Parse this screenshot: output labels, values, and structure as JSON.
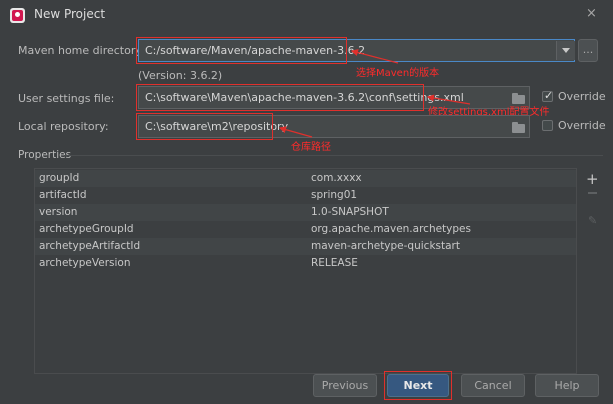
{
  "window": {
    "title": "New Project",
    "close_glyph": "×"
  },
  "form": {
    "maven_home_label": "Maven home directory:",
    "maven_home_value": "C:/software/Maven/apache-maven-3.6.2",
    "maven_version": "(Version: 3.6.2)",
    "settings_label": "User settings file:",
    "settings_value": "C:\\software\\Maven\\apache-maven-3.6.2\\conf\\settings.xml",
    "settings_override_label": "Override",
    "settings_override_checked": true,
    "repo_label": "Local repository:",
    "repo_value": "C:\\software\\m2\\repository",
    "repo_override_label": "Override",
    "repo_override_checked": false,
    "browse_label": "..."
  },
  "annotations": {
    "maven_version_note": "选择Maven的版本",
    "settings_note": "修改settings.xml配置文件",
    "repo_note": "仓库路径"
  },
  "properties": {
    "section_label": "Properties",
    "rows": [
      {
        "key": "groupId",
        "value": "com.xxxx"
      },
      {
        "key": "artifactId",
        "value": "spring01"
      },
      {
        "key": "version",
        "value": "1.0-SNAPSHOT"
      },
      {
        "key": "archetypeGroupId",
        "value": "org.apache.maven.archetypes"
      },
      {
        "key": "archetypeArtifactId",
        "value": "maven-archetype-quickstart"
      },
      {
        "key": "archetypeVersion",
        "value": "RELEASE"
      }
    ]
  },
  "buttons": {
    "previous": "Previous",
    "next": "Next",
    "cancel": "Cancel",
    "help": "Help"
  },
  "colors": {
    "background": "#3c3f41",
    "field": "#45494a",
    "annotation_red": "#e0302c",
    "primary_button": "#365880",
    "focus_blue": "#4a88c7"
  }
}
